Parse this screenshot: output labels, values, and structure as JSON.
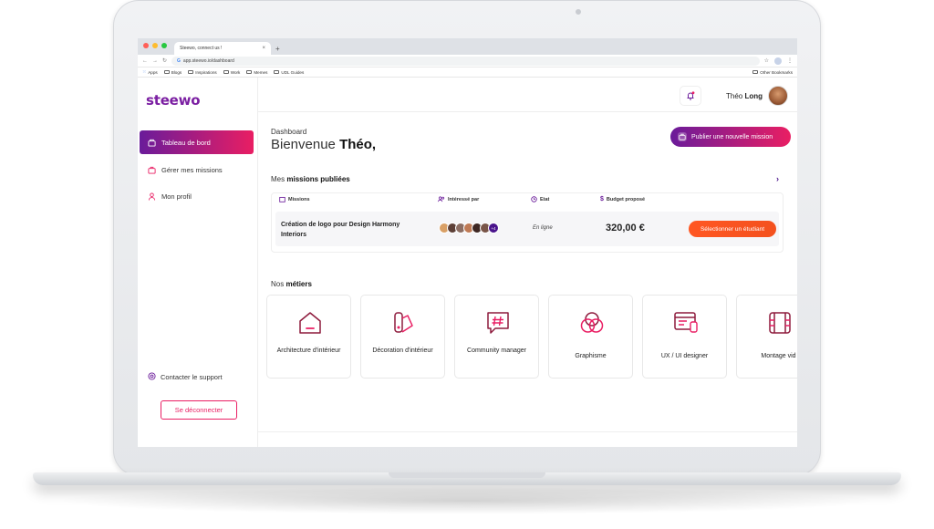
{
  "browser": {
    "tab_title": "Steewo, connect us !",
    "tab_close": "×",
    "new_tab": "+",
    "url": "app.steewo.io/dashboard",
    "bookmarks": [
      "Apps",
      "Blogs",
      "Inspirations",
      "Work",
      "Memes",
      "UDL Guides"
    ],
    "other_bookmarks": "Other Bookmarks"
  },
  "sidebar": {
    "logo": "steewo",
    "items": [
      {
        "label": "Tableau de bord",
        "icon": "dashboard-icon",
        "active": true
      },
      {
        "label": "Gérer mes missions",
        "icon": "briefcase-icon",
        "active": false
      },
      {
        "label": "Mon profil",
        "icon": "user-icon",
        "active": false
      }
    ],
    "support": "Contacter le support",
    "logout": "Se déconnecter"
  },
  "header": {
    "user_first": "Théo",
    "user_last": "Long"
  },
  "main": {
    "breadcrumb": "Dashboard",
    "welcome_prefix": "Bienvenue",
    "welcome_name": "Théo,",
    "publish_button": "Publier une nouvelle mission",
    "missions_title_prefix": "Mes",
    "missions_title_bold": "missions publiées",
    "table_headers": {
      "missions": "Missions",
      "interested": "Intéressé par",
      "state": "Etat",
      "budget": "Budget proposé"
    },
    "mission": {
      "name": "Création de logo pour Design Harmony Interiors",
      "extra_count": "+4",
      "state": "En ligne",
      "budget": "320,00 €",
      "select_button": "Sélectionner un étudiant"
    },
    "metiers_title_prefix": "Nos",
    "metiers_title_bold": "métiers",
    "metiers": [
      {
        "label": "Architecture d'intérieur",
        "icon": "house-icon"
      },
      {
        "label": "Décoration d'intérieur",
        "icon": "swatch-icon"
      },
      {
        "label": "Community manager",
        "icon": "hashtag-chat-icon"
      },
      {
        "label": "Graphisme",
        "icon": "color-circles-icon"
      },
      {
        "label": "UX / UI designer",
        "icon": "ui-layout-icon"
      },
      {
        "label": "Montage vid",
        "icon": "film-icon"
      }
    ]
  },
  "colors": {
    "brand_purple": "#6a1b9a",
    "brand_pink": "#e91e63",
    "accent_orange": "#ff5722"
  }
}
